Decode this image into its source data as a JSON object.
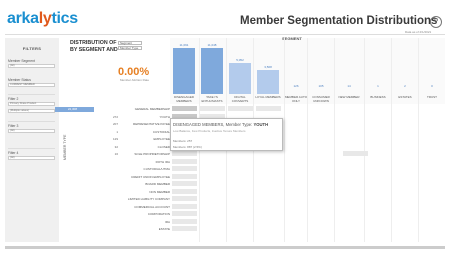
{
  "header": {
    "logo_a": "arka",
    "logo_b": "ly",
    "logo_c": "tics",
    "title": "Member Segmentation Distributions",
    "subtitle": "Data as of 2/1/2021",
    "help": "?"
  },
  "filters": {
    "heading": "FILTERS",
    "items": [
      {
        "label": "Member Segment",
        "value": "(All)"
      },
      {
        "label": "Member Status",
        "value": "CURRENT MEMBER"
      },
      {
        "label": "Filter 2",
        "value": "Primary Share Product"
      },
      {
        "label": "",
        "value": "(Multiple values)"
      },
      {
        "label": "Filter 3",
        "value": "(All)"
      },
      {
        "label": "Filter 4",
        "value": "(All)"
      }
    ]
  },
  "controls": {
    "dropdown1": "Segment",
    "dropdown2": "Member Type",
    "distribution_label": "DISTRIBUTION OF BY SEGMENT AND",
    "segment_header": "SEGMENT",
    "percentage": "0.00%",
    "percentage_label": "Member Attrition Rate",
    "member_type_axis": "MEMBER TYPE"
  },
  "segments": [
    {
      "label": "DISENGAGED MEMBERS",
      "value": "11,091"
    },
    {
      "label": "TAKE I'S ENTHUSIASTS",
      "value": "11,048"
    },
    {
      "label": "DIGITAL CONVERTS",
      "value": "5,052"
    },
    {
      "label": "LOYAL MEMBERS",
      "value": "3,568"
    },
    {
      "label": "MEMBER AUTO ONLY",
      "value": "126"
    },
    {
      "label": "CONSUMER UNKNOWN",
      "value": "105"
    },
    {
      "label": "NEW MEMBER",
      "value": "14"
    },
    {
      "label": "BUSINESS",
      "value": "1"
    },
    {
      "label": "ESTATES",
      "value": "2"
    },
    {
      "label": "TRUST",
      "value": "0"
    }
  ],
  "rows": [
    {
      "value": "22,308",
      "label": "GENERAL MEMBERSHIP"
    },
    {
      "value": "272",
      "label": "YOUTH"
    },
    {
      "value": "207",
      "label": "REPRESENTATIVE PAYEE"
    },
    {
      "value": "1",
      "label": "CUSTODIAL"
    },
    {
      "value": "129",
      "label": "EMPLOYEE"
    },
    {
      "value": "32",
      "label": "CLOSED"
    },
    {
      "value": "16",
      "label": "SOLE PROPRIETORSHIP"
    },
    {
      "value": "",
      "label": "ROTH IRA"
    },
    {
      "value": "",
      "label": "CUSTODIAL/UTMA"
    },
    {
      "value": "",
      "label": "CREDIT UNION EMPLOYEE"
    },
    {
      "value": "",
      "label": "BOARD MEMBER"
    },
    {
      "value": "",
      "label": "NON MEMBER"
    },
    {
      "value": "",
      "label": "LIMITED LIABILITY COMPANY"
    },
    {
      "value": "",
      "label": "COMMERCIAL ACCOUNT"
    },
    {
      "value": "",
      "label": "CORPORATION"
    },
    {
      "value": "",
      "label": "IRA"
    },
    {
      "value": "",
      "label": "ESTATE"
    }
  ],
  "tooltip": {
    "segment": "DISENGAGED MEMBERS",
    "type_label": "Member Type:",
    "type": "YOUTH",
    "description": "Low Balance, Few Products, Inactive Tenure Members",
    "line1": "Members: 257",
    "line2": "Members: 887 (2.5%)"
  }
}
